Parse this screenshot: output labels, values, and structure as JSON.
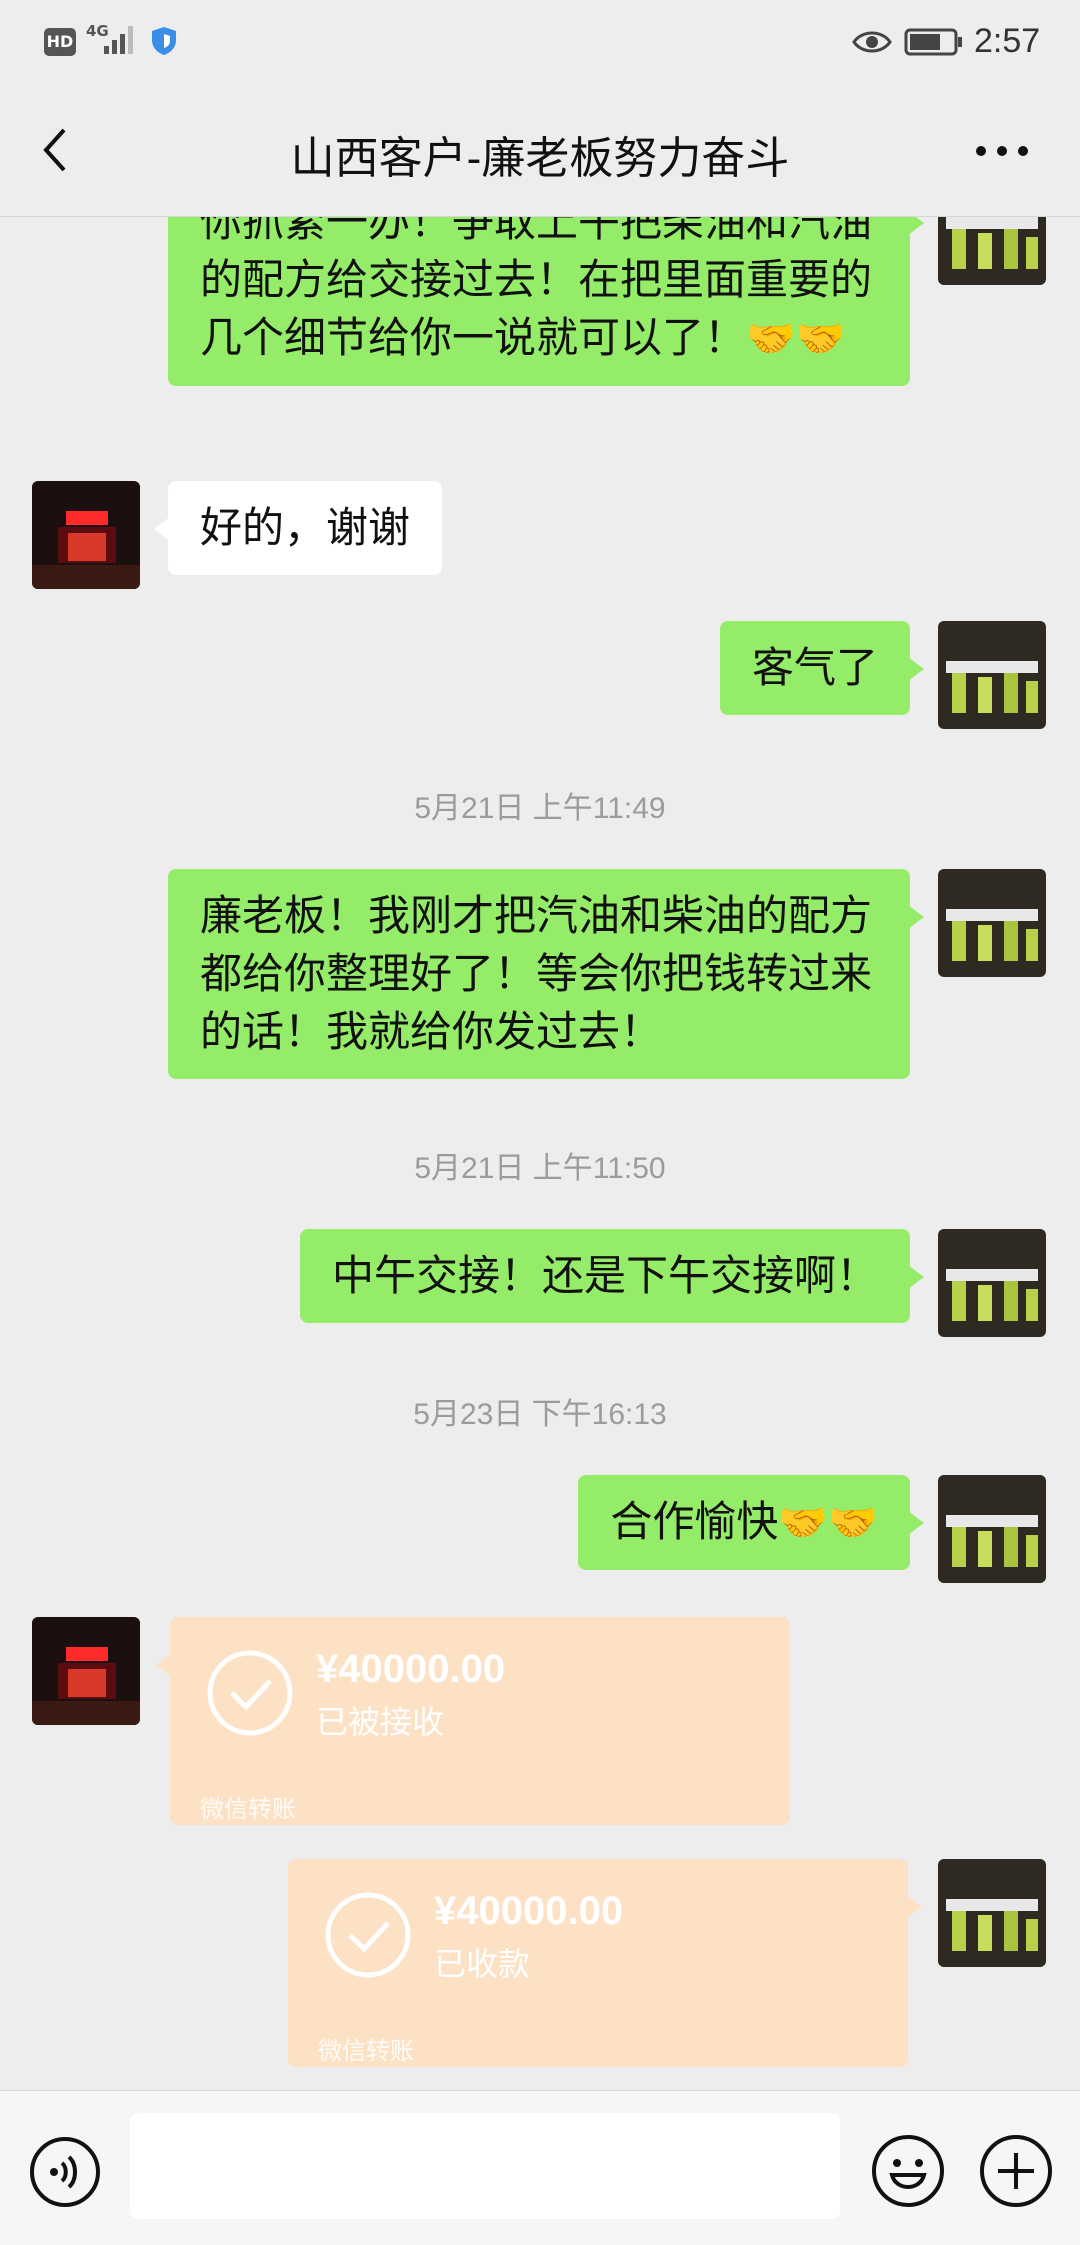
{
  "status_bar": {
    "hd": "HD",
    "network": "4G",
    "time": "2:57"
  },
  "header": {
    "title": "山西客户-廉老板努力奋斗"
  },
  "messages": {
    "m1": {
      "text": "你抓紧一办！争取上午把柴油和汽油的配方给交接过去！在把里面重要的几个细节给你一说就可以了！",
      "emoji": "🤝🤝"
    },
    "m2": {
      "text": "好的，谢谢"
    },
    "m3": {
      "text": "客气了"
    },
    "ts1": "5月21日 上午11:49",
    "m4": {
      "text": "廉老板！我刚才把汽油和柴油的配方都给你整理好了！等会你把钱转过来的话！我就给你发过去！"
    },
    "ts2": "5月21日 上午11:50",
    "m5": {
      "text": "中午交接！还是下午交接啊！"
    },
    "ts3": "5月23日 下午16:13",
    "m6": {
      "text": "合作愉快",
      "emoji": "🤝🤝"
    },
    "t1": {
      "amount": "¥40000.00",
      "status": "已被接收",
      "label": "微信转账"
    },
    "t2": {
      "amount": "¥40000.00",
      "status": "已收款",
      "label": "微信转账"
    }
  },
  "input": {
    "value": ""
  },
  "colors": {
    "outgoing_bubble": "#95ec69",
    "incoming_bubble": "#ffffff",
    "transfer_card": "#fde1c4",
    "background": "#ededed"
  }
}
